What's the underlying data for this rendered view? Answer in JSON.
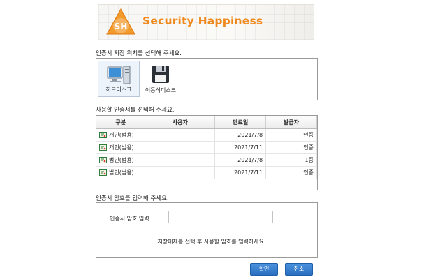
{
  "banner": {
    "brand": "Security Happiness",
    "logo_text": "SH",
    "brand_color": "#f08a1e"
  },
  "storage": {
    "title": "인증서 저장 위치를 선택해 주세요.",
    "options": [
      {
        "label": "하드디스크",
        "icon": "hard-disk-icon",
        "selected": true
      },
      {
        "label": "이동식디스크",
        "icon": "removable-disk-icon",
        "selected": false
      }
    ]
  },
  "certs": {
    "title": "사용할 인증서를 선택해 주세요.",
    "columns": [
      "구분",
      "사용자",
      "만료일",
      "발급자"
    ],
    "rows": [
      {
        "type": "개인(범용)",
        "user": "",
        "expiry": "2021/7/8",
        "issuer": "인증"
      },
      {
        "type": "개인(범용)",
        "user": "",
        "expiry": "2021/7/11",
        "issuer": "인증"
      },
      {
        "type": "법인(범용)",
        "user": "",
        "expiry": "2021/7/8",
        "issuer": "1증"
      },
      {
        "type": "법인(범용)",
        "user": "",
        "expiry": "2021/7/11",
        "issuer": "인증"
      }
    ]
  },
  "password": {
    "title": "인증서 암호를 입력해 주세요.",
    "field_label": "인증서 암호 입력:",
    "value": "",
    "hint": "저장매체를 선택 후 사용할 암호를 입력하세요."
  },
  "buttons": {
    "ok": "확인",
    "cancel": "취소"
  }
}
